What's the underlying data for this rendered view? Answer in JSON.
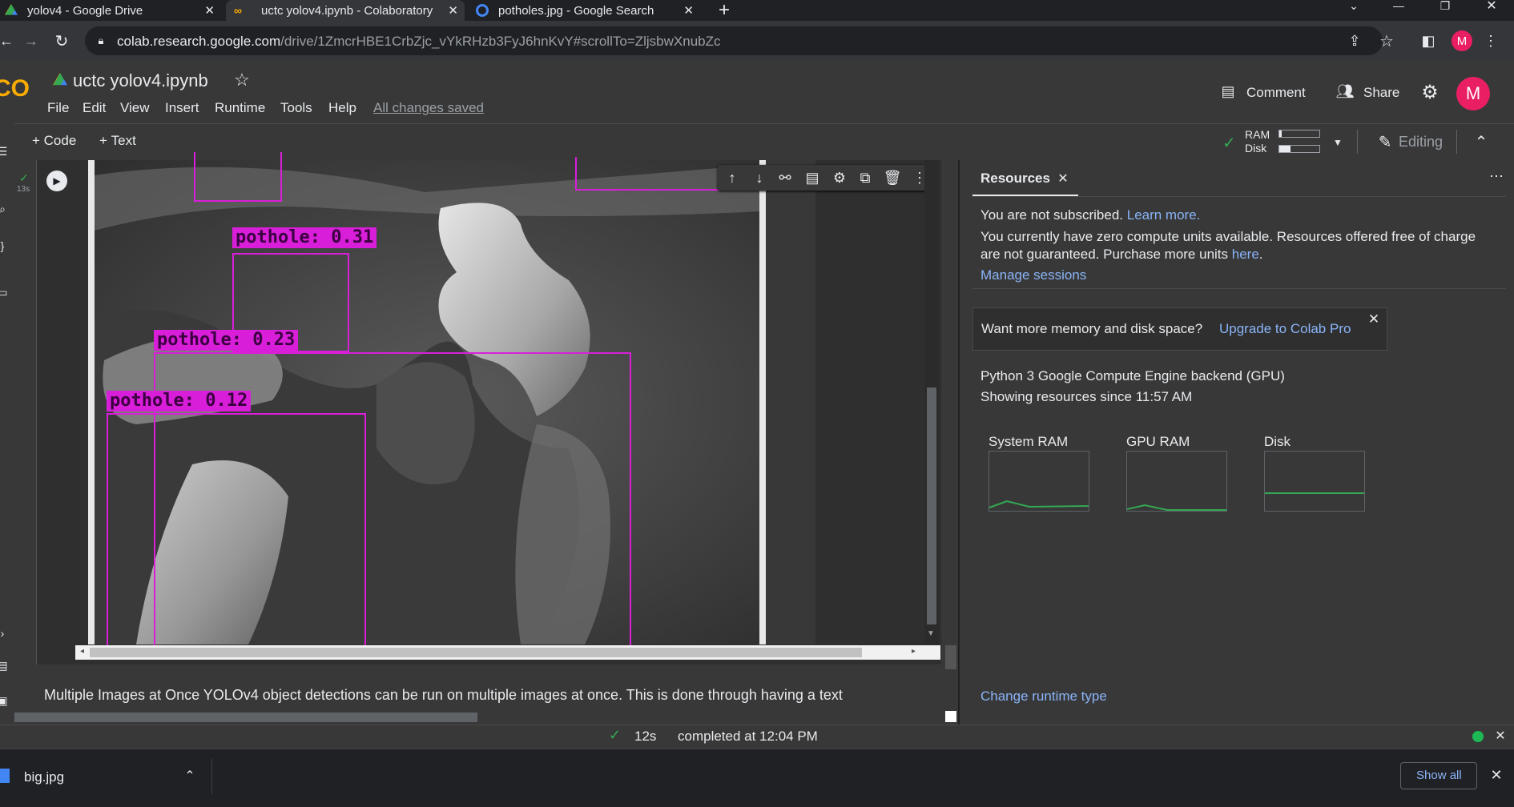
{
  "tabs": [
    {
      "title": "yolov4 - Google Drive"
    },
    {
      "title": "uctc yolov4.ipynb - Colaboratory"
    },
    {
      "title": "potholes.jpg - Google Search"
    }
  ],
  "address": {
    "host": "colab.research.google.com",
    "path": "/drive/1ZmcrHBE1CrbZjc_vYkRHzb3FyJ6hnKvY#scrollTo=ZljsbwXnubZc"
  },
  "notebook": {
    "title": "uctc yolov4.ipynb",
    "save_status": "All changes saved"
  },
  "menu": [
    "File",
    "Edit",
    "View",
    "Insert",
    "Runtime",
    "Tools",
    "Help"
  ],
  "header_actions": {
    "comment": "Comment",
    "share": "Share",
    "avatar": "M"
  },
  "toolbar": {
    "code": "Code",
    "text": "Text",
    "ram": "RAM",
    "disk": "Disk",
    "editing": "Editing"
  },
  "cell": {
    "exec_time": "13s"
  },
  "detections": [
    {
      "label": "pothole: 0.31"
    },
    {
      "label": "pothole: 0.23"
    },
    {
      "label": "pothole: 0.12"
    }
  ],
  "text_cell": "Multiple Images at Once YOLOv4 object detections can be run on multiple images at once. This is done through having a text",
  "resources": {
    "tab_title": "Resources",
    "not_subscribed": "You are not subscribed.",
    "learn_more": "Learn more.",
    "compute_units": "You currently have zero compute units available. Resources offered free of charge are not guaranteed. Purchase more units",
    "here": "here",
    "manage_sessions": "Manage sessions",
    "promo": "Want more memory and disk space?",
    "upgrade": "Upgrade to Colab Pro",
    "backend": "Python 3 Google Compute Engine backend (GPU)",
    "since": "Showing resources since 11:57 AM",
    "gauges": [
      "System RAM",
      "GPU RAM",
      "Disk"
    ],
    "change_runtime": "Change runtime type"
  },
  "status": {
    "duration": "12s",
    "completed": "completed at 12:04 PM"
  },
  "downloads": {
    "file": "big.jpg",
    "show_all": "Show all"
  },
  "colors": {
    "accent": "#8ab4f8",
    "bbox": "#d91ed9",
    "ok": "#34a853"
  }
}
